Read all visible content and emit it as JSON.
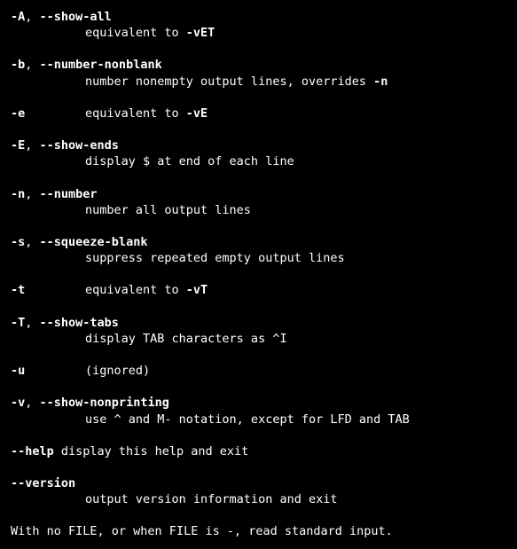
{
  "options": {
    "A": {
      "short": "-A",
      "sep": ", ",
      "long": "--show-all",
      "desc_pre": "equivalent to ",
      "desc_bold": "-vET",
      "desc_post": ""
    },
    "b": {
      "short": "-b",
      "sep": ", ",
      "long": "--number-nonblank",
      "desc_pre": "number nonempty output lines, overrides ",
      "desc_bold": "-n",
      "desc_post": ""
    },
    "e": {
      "short": "-e",
      "desc_pre": "equivalent to ",
      "desc_bold": "-vE",
      "desc_post": ""
    },
    "E": {
      "short": "-E",
      "sep": ", ",
      "long": "--show-ends",
      "desc": "display $ at end of each line"
    },
    "n": {
      "short": "-n",
      "sep": ", ",
      "long": "--number",
      "desc": "number all output lines"
    },
    "s": {
      "short": "-s",
      "sep": ", ",
      "long": "--squeeze-blank",
      "desc": "suppress repeated empty output lines"
    },
    "t": {
      "short": "-t",
      "desc_pre": "equivalent to ",
      "desc_bold": "-vT",
      "desc_post": ""
    },
    "T": {
      "short": "-T",
      "sep": ", ",
      "long": "--show-tabs",
      "desc": "display TAB characters as ^I"
    },
    "u": {
      "short": "-u",
      "desc": "(ignored)"
    },
    "v": {
      "short": "-v",
      "sep": ", ",
      "long": "--show-nonprinting",
      "desc": "use ^ and M- notation, except for LFD and TAB"
    },
    "help": {
      "long": "--help",
      "desc_inline": " display this help and exit"
    },
    "version": {
      "long": "--version",
      "desc": "output version information and exit"
    }
  },
  "footer": "With no FILE, or when FILE is -, read standard input."
}
